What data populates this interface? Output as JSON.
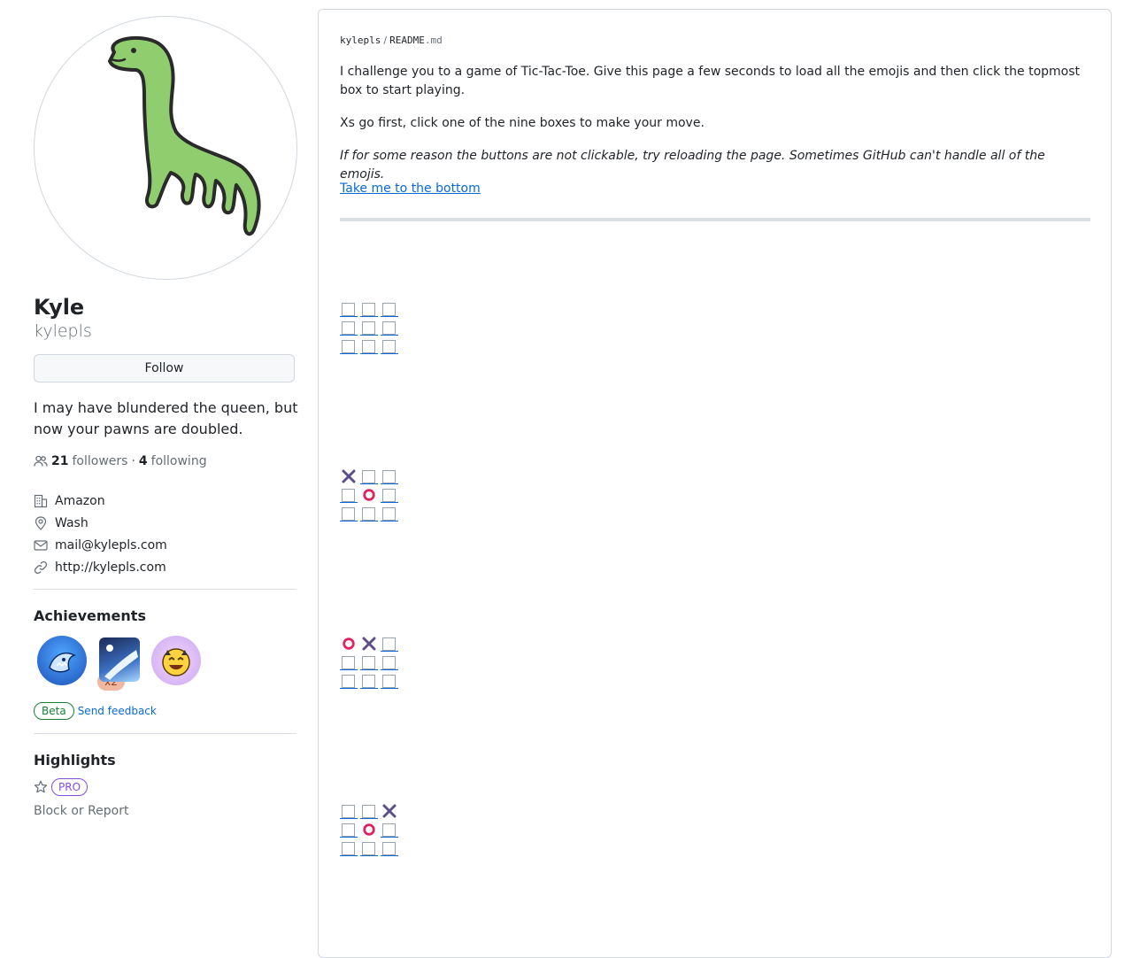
{
  "profile": {
    "name": "Kyle",
    "login": "kylepls",
    "follow_label": "Follow",
    "bio": "I may have blundered the queen, but now your pawns are doubled.",
    "followers_count": "21",
    "followers_label": "followers",
    "following_count": "4",
    "following_label": "following",
    "separator": "·",
    "details": {
      "company": "Amazon",
      "location": "Wash",
      "email": "mail@kylepls.com",
      "website": "http://kylepls.com"
    }
  },
  "achievements": {
    "title": "Achievements",
    "badges": [
      "shark-badge",
      "arctic-badge",
      "starstruck-badge"
    ],
    "first_badge_count": "x2",
    "beta_label": "Beta",
    "feedback_label": "Send feedback"
  },
  "highlights": {
    "title": "Highlights",
    "pro_label": "PRO",
    "block_report": "Block or Report"
  },
  "readme": {
    "path_user": "kylepls",
    "path_separator": "/",
    "path_file": "README",
    "path_ext": ".md",
    "intro": "I challenge you to a game of Tic-Tac-Toe. Give this page a few seconds to load all the emojis and then click the topmost box to start playing.",
    "instruction": "Xs go first, click one of the nine boxes to make your move.",
    "note": "If for some reason the buttons are not clickable, try reloading the page. Sometimes GitHub can't handle all of the emojis.",
    "bottom_link": "Take me to the bottom",
    "boards": [
      [
        "",
        "",
        "",
        "",
        "",
        "",
        "",
        "",
        ""
      ],
      [
        "X",
        "",
        "",
        "",
        "O",
        "",
        "",
        "",
        ""
      ],
      [
        "O",
        "X",
        "",
        "",
        "",
        "",
        "",
        "",
        ""
      ],
      [
        "",
        "",
        "X",
        "",
        "O",
        "",
        "",
        "",
        ""
      ]
    ]
  },
  "colors": {
    "x_mark": "#5c4e8a",
    "o_mark": "#e0245e",
    "link": "#0969da",
    "beta": "#1a7f37",
    "pro": "#8250df"
  }
}
